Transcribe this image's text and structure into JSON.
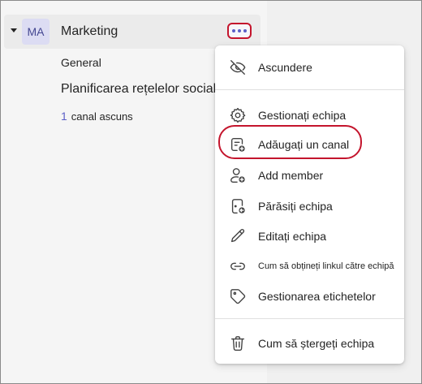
{
  "team": {
    "avatar_initials": "MA",
    "name": "Marketing"
  },
  "channels": [
    {
      "label": "General"
    },
    {
      "label": "Planificarea rețelelor sociale"
    }
  ],
  "hidden_channels": {
    "count": "1",
    "label": "canal ascuns"
  },
  "menu": {
    "items": [
      {
        "label": "Ascundere",
        "icon": "eye-off-icon"
      },
      {
        "label": "Gestionați echipa",
        "icon": "gear-icon"
      },
      {
        "label": "Adăugați un canal",
        "icon": "add-channel-icon"
      },
      {
        "label": "Add member",
        "icon": "add-person-icon"
      },
      {
        "label": "Părăsiți echipa",
        "icon": "leave-team-icon"
      },
      {
        "label": "Editați echipa",
        "icon": "pencil-icon"
      },
      {
        "label": "Cum să obțineți linkul către echipă",
        "icon": "link-icon"
      },
      {
        "label": "Gestionarea etichetelor",
        "icon": "tag-icon"
      },
      {
        "label": "Cum să ștergeți echipa",
        "icon": "trash-icon"
      }
    ]
  },
  "colors": {
    "accent": "#5b5fc7",
    "highlight": "#c4152d",
    "avatar_bg": "#dcdcf3"
  }
}
